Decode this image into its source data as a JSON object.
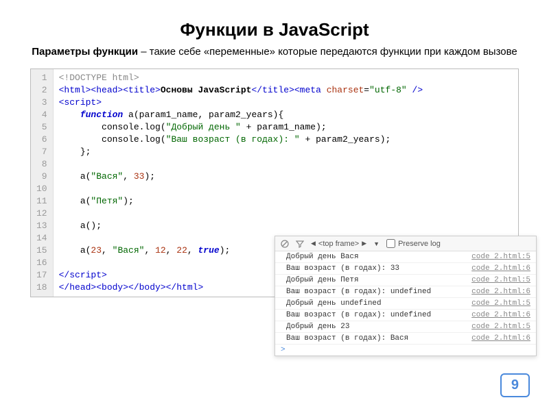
{
  "title": "Функции в JavaScript",
  "subtitle_lead": "Параметры функции",
  "subtitle_rest": " – такие себе «переменные» которые передаются функции при каждом вызове",
  "code": {
    "l1": "<!DOCTYPE html>",
    "l2a": "<html><head><title>",
    "l2b": "Основы JavaScript",
    "l2c": "</title><meta ",
    "l2d": "charset",
    "l2e": "=",
    "l2f": "\"utf-8\"",
    "l2g": " />",
    "l3": "<script>",
    "l4a": "    function",
    "l4b": " a(param1_name, param2_years){",
    "l5a": "        console.log(",
    "l5b": "\"Добрый день \"",
    "l5c": " + param1_name);",
    "l6a": "        console.log(",
    "l6b": "\"Ваш возраст (в годах): \"",
    "l6c": " + param2_years);",
    "l7": "    };",
    "l9a": "    a(",
    "l9b": "\"Вася\"",
    "l9c": ", ",
    "l9d": "33",
    "l9e": ");",
    "l11a": "    a(",
    "l11b": "\"Петя\"",
    "l11c": ");",
    "l13": "    a();",
    "l15a": "    a(",
    "l15b": "23",
    "l15c": ", ",
    "l15d": "\"Вася\"",
    "l15e": ", ",
    "l15f": "12",
    "l15g": ", ",
    "l15h": "22",
    "l15i": ", ",
    "l15j": "true",
    "l15k": ");",
    "l17": "</script>",
    "l18": "</head><body></body></html>"
  },
  "gutter": [
    "1",
    "2",
    "3",
    "4",
    "5",
    "6",
    "7",
    "8",
    "9",
    "10",
    "11",
    "12",
    "13",
    "14",
    "15",
    "16",
    "17",
    "18"
  ],
  "console": {
    "frame_label": "<top frame>",
    "preserve_label": "Preserve log",
    "rows": [
      {
        "msg": "Добрый день Вася",
        "src": "code 2.html:5"
      },
      {
        "msg": "Ваш возраст (в годах): 33",
        "src": "code 2.html:6"
      },
      {
        "msg": "Добрый день Петя",
        "src": "code 2.html:5"
      },
      {
        "msg": "Ваш возраст (в годах): undefined",
        "src": "code 2.html:6"
      },
      {
        "msg": "Добрый день undefined",
        "src": "code 2.html:5"
      },
      {
        "msg": "Ваш возраст (в годах): undefined",
        "src": "code 2.html:6"
      },
      {
        "msg": "Добрый день 23",
        "src": "code 2.html:5"
      },
      {
        "msg": "Ваш возраст (в годах): Вася",
        "src": "code 2.html:6"
      }
    ],
    "prompt": ">"
  },
  "page_number": "9"
}
